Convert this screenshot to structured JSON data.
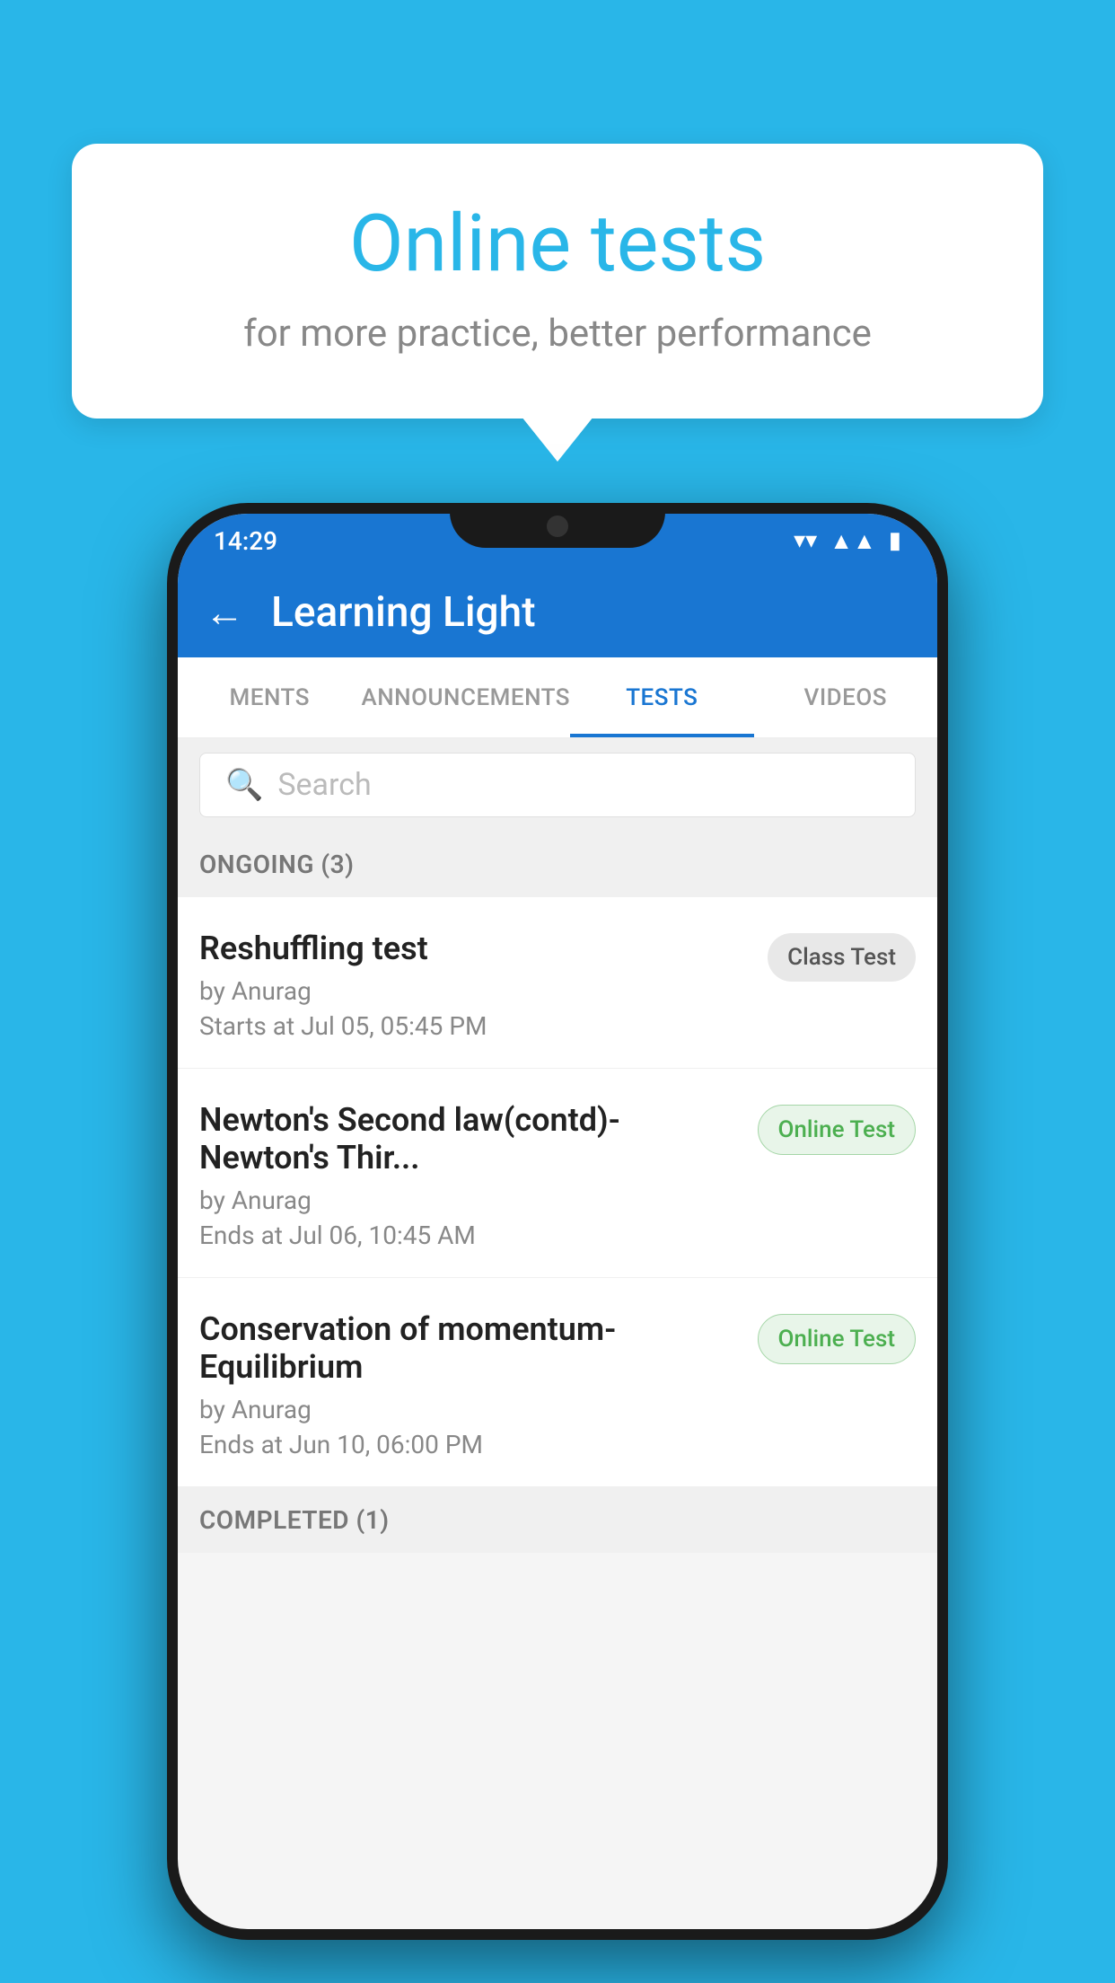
{
  "background": {
    "color": "#29B6E8"
  },
  "speech_bubble": {
    "title": "Online tests",
    "subtitle": "for more practice, better performance"
  },
  "status_bar": {
    "time": "14:29",
    "wifi": "▼",
    "signal": "◀",
    "battery": "▉"
  },
  "toolbar": {
    "back_label": "←",
    "title": "Learning Light"
  },
  "tabs": [
    {
      "label": "MENTS",
      "active": false
    },
    {
      "label": "ANNOUNCEMENTS",
      "active": false
    },
    {
      "label": "TESTS",
      "active": true
    },
    {
      "label": "VIDEOS",
      "active": false
    }
  ],
  "search": {
    "placeholder": "Search"
  },
  "section_ongoing": {
    "title": "ONGOING (3)"
  },
  "tests": [
    {
      "name": "Reshuffling test",
      "author": "by Anurag",
      "time_label": "Starts at",
      "time": "Jul 05, 05:45 PM",
      "badge": "Class Test",
      "badge_type": "class"
    },
    {
      "name": "Newton's Second law(contd)-Newton's Thir...",
      "author": "by Anurag",
      "time_label": "Ends at",
      "time": "Jul 06, 10:45 AM",
      "badge": "Online Test",
      "badge_type": "online"
    },
    {
      "name": "Conservation of momentum-Equilibrium",
      "author": "by Anurag",
      "time_label": "Ends at",
      "time": "Jun 10, 06:00 PM",
      "badge": "Online Test",
      "badge_type": "online"
    }
  ],
  "section_completed": {
    "title": "COMPLETED (1)"
  }
}
